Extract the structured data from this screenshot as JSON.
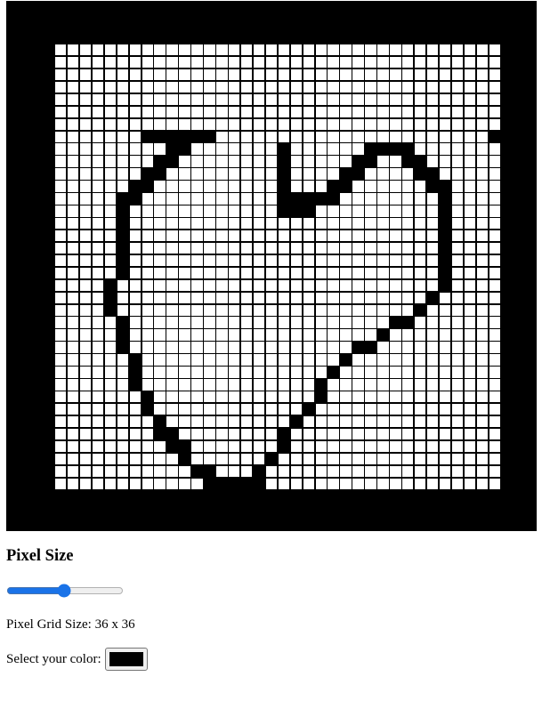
{
  "heading": "Pixel Size",
  "slider": {
    "value": 36,
    "min": 1,
    "max": 72
  },
  "grid_size_text": "Pixel Grid Size: 36 x 36",
  "color_label": "Select your color:",
  "selected_color": "#000000",
  "grid": {
    "cols": 36,
    "rows": 36,
    "filled": [
      [
        7,
        12
      ],
      [
        8,
        12
      ],
      [
        9,
        12
      ],
      [
        10,
        12
      ],
      [
        11,
        12
      ],
      [
        12,
        12
      ],
      [
        35,
        12
      ],
      [
        9,
        13
      ],
      [
        10,
        13
      ],
      [
        18,
        13
      ],
      [
        25,
        13
      ],
      [
        26,
        13
      ],
      [
        27,
        13
      ],
      [
        28,
        13
      ],
      [
        8,
        14
      ],
      [
        9,
        14
      ],
      [
        18,
        14
      ],
      [
        24,
        14
      ],
      [
        25,
        14
      ],
      [
        28,
        14
      ],
      [
        29,
        14
      ],
      [
        7,
        15
      ],
      [
        8,
        15
      ],
      [
        18,
        15
      ],
      [
        23,
        15
      ],
      [
        24,
        15
      ],
      [
        29,
        15
      ],
      [
        30,
        15
      ],
      [
        6,
        16
      ],
      [
        7,
        16
      ],
      [
        18,
        16
      ],
      [
        22,
        16
      ],
      [
        23,
        16
      ],
      [
        30,
        16
      ],
      [
        31,
        16
      ],
      [
        5,
        17
      ],
      [
        6,
        17
      ],
      [
        18,
        17
      ],
      [
        19,
        17
      ],
      [
        20,
        17
      ],
      [
        21,
        17
      ],
      [
        22,
        17
      ],
      [
        31,
        17
      ],
      [
        5,
        18
      ],
      [
        18,
        18
      ],
      [
        19,
        18
      ],
      [
        20,
        18
      ],
      [
        31,
        18
      ],
      [
        5,
        19
      ],
      [
        31,
        19
      ],
      [
        5,
        20
      ],
      [
        31,
        20
      ],
      [
        5,
        21
      ],
      [
        31,
        21
      ],
      [
        5,
        22
      ],
      [
        31,
        22
      ],
      [
        5,
        23
      ],
      [
        31,
        23
      ],
      [
        4,
        24
      ],
      [
        31,
        24
      ],
      [
        4,
        25
      ],
      [
        30,
        25
      ],
      [
        4,
        26
      ],
      [
        29,
        26
      ],
      [
        5,
        27
      ],
      [
        28,
        27
      ],
      [
        5,
        28
      ],
      [
        27,
        28
      ],
      [
        5,
        29
      ],
      [
        26,
        29
      ],
      [
        5,
        30
      ],
      [
        24,
        30
      ],
      [
        25,
        30
      ],
      [
        6,
        31
      ],
      [
        23,
        31
      ],
      [
        6,
        32
      ],
      [
        22,
        32
      ],
      [
        6,
        33
      ],
      [
        21,
        33
      ],
      [
        7,
        34
      ],
      [
        21,
        34
      ],
      [
        7,
        35
      ],
      [
        20,
        35
      ],
      [
        8,
        36
      ],
      [
        19,
        36
      ],
      [
        8,
        37
      ],
      [
        9,
        37
      ],
      [
        18,
        37
      ],
      [
        9,
        38
      ],
      [
        10,
        38
      ],
      [
        18,
        38
      ],
      [
        10,
        39
      ],
      [
        17,
        39
      ],
      [
        11,
        40
      ],
      [
        12,
        40
      ],
      [
        16,
        40
      ],
      [
        12,
        41
      ],
      [
        15,
        41
      ],
      [
        16,
        41
      ],
      [
        13,
        42
      ],
      [
        14,
        42
      ],
      [
        15,
        42
      ]
    ]
  }
}
